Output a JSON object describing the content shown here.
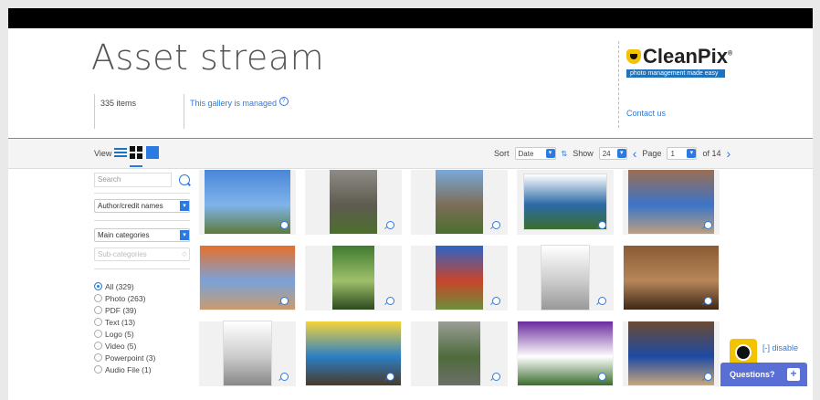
{
  "header": {
    "title": "Asset stream",
    "item_count": "335 items",
    "managed_text": "This gallery is managed",
    "help_mark": "?",
    "contact": "Contact us"
  },
  "logo": {
    "brand_clean": "Clean",
    "brand_pix": "Pix",
    "brand_reg": "®",
    "tagline": "photo management made easy"
  },
  "toolbar": {
    "view_label": "View",
    "sort_label": "Sort",
    "sort_value": "Date",
    "show_label": "Show",
    "show_value": "24",
    "page_label": "Page",
    "page_value": "1",
    "page_total": "of 14",
    "prev_icon": "‹",
    "next_icon": "›"
  },
  "sidebar": {
    "search_placeholder": "Search",
    "author_select": "Author/credit names",
    "main_categories": "Main categories",
    "sub_categories": "Sub-categories",
    "filters": [
      {
        "label": "All (329)",
        "selected": true
      },
      {
        "label": "Photo (263)",
        "selected": false
      },
      {
        "label": "PDF (39)",
        "selected": false
      },
      {
        "label": "Text (13)",
        "selected": false
      },
      {
        "label": "Logo (5)",
        "selected": false
      },
      {
        "label": "Video (5)",
        "selected": false
      },
      {
        "label": "Powerpoint (3)",
        "selected": false
      },
      {
        "label": "Audio File (1)",
        "selected": false
      }
    ]
  },
  "thumbnails": [
    {
      "name": "sky-tree",
      "colors": [
        "#4a86d9",
        "#7fb4ea",
        "#5d7a3b"
      ]
    },
    {
      "name": "boardwalk",
      "colors": [
        "#8e8c86",
        "#5e5b50",
        "#4d6f2c"
      ]
    },
    {
      "name": "garden-path",
      "colors": [
        "#79a9d8",
        "#7c6d58",
        "#4b6e2e"
      ]
    },
    {
      "name": "pdf-brochure",
      "colors": [
        "#ffffff",
        "#2c6aa7",
        "#3b6d2e"
      ]
    },
    {
      "name": "brick-building",
      "colors": [
        "#9b6e52",
        "#3b74c8",
        "#bca07f"
      ]
    },
    {
      "name": "autumn-tower",
      "colors": [
        "#e8702a",
        "#7aa2d9",
        "#c89b6d"
      ]
    },
    {
      "name": "palm-leaves",
      "colors": [
        "#3f7a30",
        "#9fc06b",
        "#2b4a1e"
      ]
    },
    {
      "name": "red-tree",
      "colors": [
        "#2e63c7",
        "#c8452b",
        "#6a8f3a"
      ]
    },
    {
      "name": "document-page",
      "colors": [
        "#ffffff",
        "#cccccc",
        "#999999"
      ]
    },
    {
      "name": "branches-brown",
      "colors": [
        "#8a5b34",
        "#b7865a",
        "#3d2716"
      ]
    },
    {
      "name": "form-document",
      "colors": [
        "#ffffff",
        "#cccccc",
        "#888888"
      ]
    },
    {
      "name": "mural-wall",
      "colors": [
        "#f4d43a",
        "#2b7fc4",
        "#4a3a2b"
      ]
    },
    {
      "name": "iron-ornament",
      "colors": [
        "#9a9d96",
        "#4f6b3c",
        "#6c6f68"
      ]
    },
    {
      "name": "purple-field",
      "colors": [
        "#6a2a9e",
        "#ffffff",
        "#3b6d2e"
      ]
    },
    {
      "name": "crowd-hall",
      "colors": [
        "#6c4a32",
        "#1d4aa3",
        "#c9a77a"
      ]
    }
  ],
  "widget": {
    "disable": "[-] disable",
    "questions": "Questions?",
    "plus": "+"
  }
}
